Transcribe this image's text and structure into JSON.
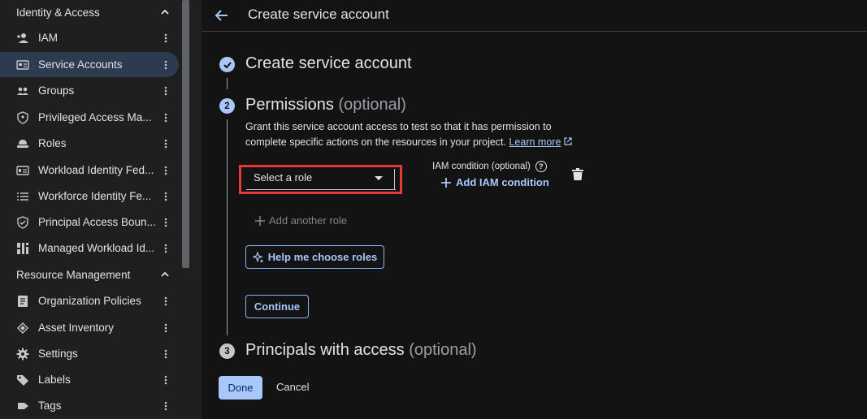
{
  "sidebar": {
    "sections": [
      {
        "title": "Identity & Access"
      },
      {
        "title": "Resource Management"
      }
    ],
    "identity_items": [
      {
        "label": "IAM",
        "icon": "person-add-icon"
      },
      {
        "label": "Service Accounts",
        "icon": "service-account-icon",
        "active": true
      },
      {
        "label": "Groups",
        "icon": "groups-icon"
      },
      {
        "label": "Privileged Access Ma...",
        "icon": "shield-icon"
      },
      {
        "label": "Roles",
        "icon": "roles-icon"
      },
      {
        "label": "Workload Identity Fed...",
        "icon": "workload-identity-icon"
      },
      {
        "label": "Workforce Identity Fe...",
        "icon": "list-icon"
      },
      {
        "label": "Principal Access Boun...",
        "icon": "boundary-icon"
      },
      {
        "label": "Managed Workload Id...",
        "icon": "managed-workload-icon"
      }
    ],
    "resource_items": [
      {
        "label": "Organization Policies",
        "icon": "policy-icon"
      },
      {
        "label": "Asset Inventory",
        "icon": "asset-icon"
      },
      {
        "label": "Settings",
        "icon": "gear-icon"
      },
      {
        "label": "Labels",
        "icon": "label-icon"
      },
      {
        "label": "Tags",
        "icon": "tag-icon"
      }
    ]
  },
  "header": {
    "title": "Create service account"
  },
  "steps": {
    "step1": {
      "title": "Create service account"
    },
    "step2": {
      "number": "2",
      "title": "Permissions",
      "optional": "(optional)"
    },
    "step3": {
      "number": "3",
      "title": "Principals with access",
      "optional": "(optional)"
    }
  },
  "permissions": {
    "description": "Grant this service account access to test so that it has permission to complete specific actions on the resources in your project.",
    "learn_more": "Learn more",
    "role_select_placeholder": "Select a role",
    "iam_condition_label": "IAM condition (optional)",
    "add_iam_condition": "Add IAM condition",
    "add_another_role": "Add another role",
    "help_choose_roles": "Help me choose roles",
    "continue": "Continue"
  },
  "footer": {
    "done": "Done",
    "cancel": "Cancel"
  },
  "colors": {
    "accent": "#a8c7fa",
    "highlight": "#e53935",
    "active_bg": "#2d3a4f"
  }
}
